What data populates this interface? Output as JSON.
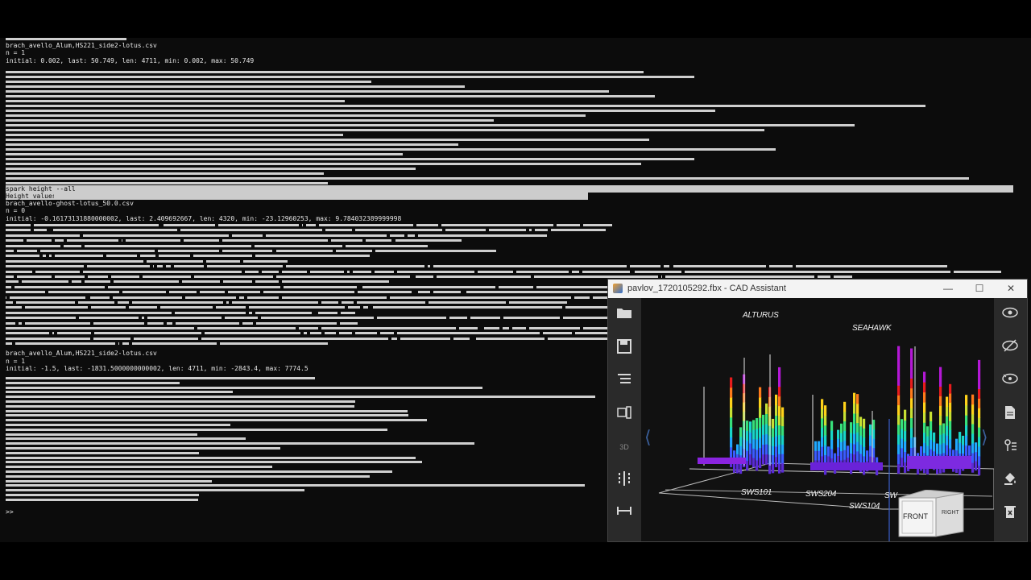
{
  "terminal": {
    "file1": "brach_avello_Alum,HS221_side2-lotus.csv",
    "n1": "n = 1",
    "stats1": "initial: 0.002, last: 50.749, len: 4711, min: 0.002, max: 50.749",
    "cmd": "spark height --all",
    "heading": "Height values",
    "file2": "brach_avello-ghost-lotus_50.0.csv",
    "n2": "n = 0",
    "stats2": "initial: -0.16173131880000002, last: 2.409692667, len: 4320, min: -23.12960253, max: 9.784032389999998",
    "file3": "brach_avello_Alum,HS221_side2-lotus.csv",
    "n3": "n = 1",
    "stats3": "initial: -1.5, last: -1831.5000000000002, len: 4711, min: -2843.4, max: 7774.5",
    "prompt": ">>"
  },
  "cad": {
    "title": "pavlov_1720105292.fbx - CAD Assistant",
    "win_min": "—",
    "win_max": "☐",
    "win_close": "✕",
    "left_tools": [
      "folder-icon",
      "save-icon",
      "layers-icon",
      "explode-icon",
      "view-3d-icon",
      "section-icon",
      "measure-icon"
    ],
    "right_tools": [
      "eye-icon",
      "hide-icon",
      "show-icon",
      "document-icon",
      "properties-icon",
      "paint-icon",
      "delete-icon"
    ],
    "labels": {
      "alturus": "ALTURUS",
      "seahawk": "SEAHAWK",
      "sws101": "SWS101",
      "sws204": "SWS204",
      "sws104": "SWS104",
      "sws_partial": "SW"
    },
    "navcube": {
      "front": "FRONT",
      "right": "RIGHT"
    },
    "nav_left": "⟨",
    "nav_right": "⟩"
  }
}
